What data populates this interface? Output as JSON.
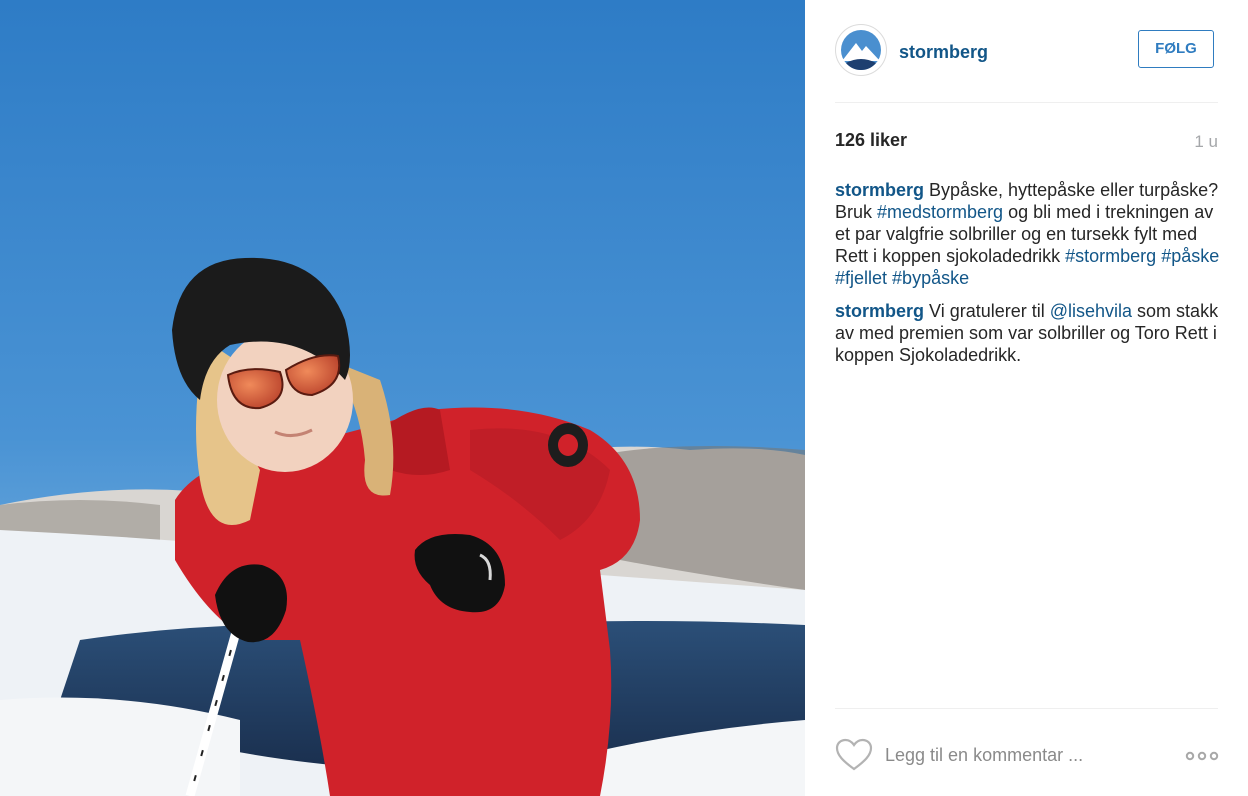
{
  "post": {
    "image_alt": "Jente i rød Stormberg-jakke med skistaver på fjellet",
    "user": {
      "username": "stormberg",
      "follow_label": "FØLG"
    },
    "likes_label": "126 liker",
    "time_ago": "1 u",
    "comments": [
      {
        "author": "stormberg",
        "parts": [
          {
            "text": " Bypåske, hyttepåske eller turpåske? Bruk "
          },
          {
            "text": "#medstormberg",
            "tag": true
          },
          {
            "text": " og bli med i trekningen av et par valgfrie solbriller og en tursekk fylt med Rett i koppen sjokoladedrikk "
          },
          {
            "text": "#stormberg",
            "tag": true
          },
          {
            "text": " "
          },
          {
            "text": "#påske",
            "tag": true
          },
          {
            "text": " "
          },
          {
            "text": "#fjellet",
            "tag": true
          },
          {
            "text": " "
          },
          {
            "text": "#bypåske",
            "tag": true
          }
        ]
      },
      {
        "author": "stormberg",
        "parts": [
          {
            "text": " Vi gratulerer til "
          },
          {
            "text": "@lisehvila",
            "tag": true
          },
          {
            "text": " som stakk av med premien som var solbriller og Toro Rett i koppen Sjokoladedrikk."
          }
        ]
      }
    ],
    "actions": {
      "like_icon": "heart-outline-icon",
      "comment_placeholder": "Legg til en kommentar ...",
      "more_icon": "ellipsis-icon"
    }
  },
  "colors": {
    "link": "#125688",
    "follow_border": "#2f7cc0",
    "sky": "#3a82c8",
    "jacket": "#d0222a"
  }
}
